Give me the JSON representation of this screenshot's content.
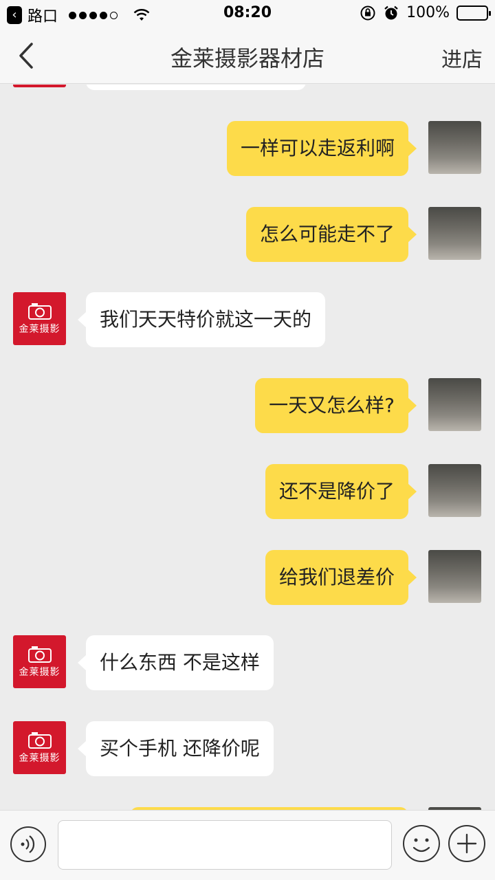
{
  "status_bar": {
    "back_app_label": "路口",
    "time": "08:20",
    "battery": "100%",
    "battery_level": 1.0,
    "icons": [
      "back-arrow-icon",
      "signal-dots-icon",
      "wifi-icon",
      "orientation-lock-icon",
      "alarm-icon",
      "battery-icon"
    ]
  },
  "nav": {
    "back_icon": "chevron-left-icon",
    "title": "金莱摄影器材店",
    "action": "进店"
  },
  "shop_avatar_text": "金莱摄影",
  "messages": [
    {
      "side": "right",
      "text": "一样可以走返利啊"
    },
    {
      "side": "right",
      "text": "怎么可能走不了"
    },
    {
      "side": "left",
      "text": "我们天天特价就这一天的"
    },
    {
      "side": "right",
      "text": "一天又怎么样?"
    },
    {
      "side": "right",
      "text": "还不是降价了"
    },
    {
      "side": "right",
      "text": "给我们退差价"
    },
    {
      "side": "left",
      "text": "什么东西 不是这样"
    },
    {
      "side": "left",
      "text": "买个手机 还降价呢"
    }
  ],
  "input_bar": {
    "placeholder": "",
    "icons": [
      "voice-icon",
      "emoji-icon",
      "plus-icon"
    ]
  },
  "colors": {
    "right_bubble": "#fddb4a",
    "left_bubble": "#ffffff",
    "shop_avatar": "#d3182c",
    "background": "#ececec"
  }
}
